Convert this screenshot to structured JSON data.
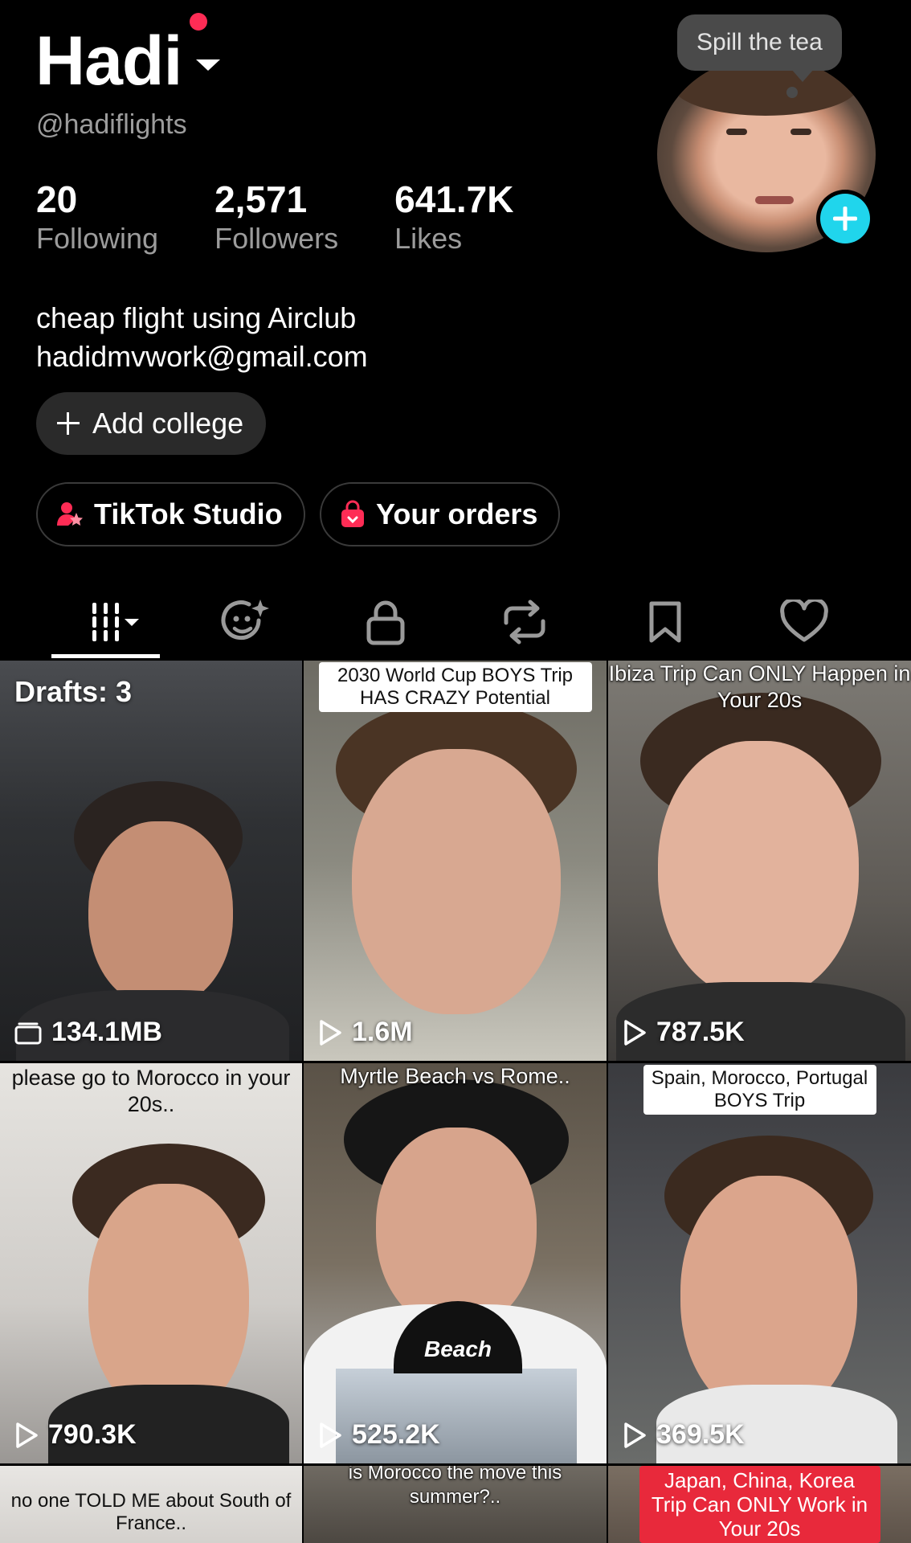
{
  "profile": {
    "name": "Hadi",
    "handle": "@hadiflights",
    "stats": [
      {
        "value": "20",
        "label": "Following"
      },
      {
        "value": "2,571",
        "label": "Followers"
      },
      {
        "value": "641.7K",
        "label": "Likes"
      }
    ],
    "bio_line1": "cheap flight using Airclub",
    "bio_line2": "hadidmvwork@gmail.com",
    "tooltip": "Spill the tea"
  },
  "buttons": {
    "add_college": "Add college",
    "studio": "TikTok Studio",
    "orders": "Your orders"
  },
  "tabs": [
    {
      "icon": "grid-icon",
      "active": true
    },
    {
      "icon": "face-sparkle-icon"
    },
    {
      "icon": "lock-icon"
    },
    {
      "icon": "repost-icon"
    },
    {
      "icon": "bookmark-icon"
    },
    {
      "icon": "heart-icon"
    }
  ],
  "videos": [
    {
      "drafts": "Drafts: 3",
      "meta": "134.1MB"
    },
    {
      "caption": "2030 World Cup BOYS Trip HAS CRAZY Potential",
      "views": "1.6M"
    },
    {
      "caption": "Ibiza Trip Can ONLY Happen in Your 20s",
      "views": "787.5K"
    },
    {
      "caption": "please go to Morocco in your 20s..",
      "views": "790.3K"
    },
    {
      "caption": "Myrtle Beach vs Rome..",
      "views": "525.2K",
      "overlay": "Beach"
    },
    {
      "caption": "Spain, Morocco, Portugal BOYS Trip",
      "views": "369.5K"
    },
    {
      "caption": "no one TOLD ME about South of France.."
    },
    {
      "caption": "is Morocco the move this summer?.."
    },
    {
      "caption": "Japan, China, Korea Trip Can ONLY Work in Your 20s"
    }
  ],
  "colors": {
    "background": "#000000",
    "accent_red": "#fe2c55",
    "accent_cyan": "#20d5ec",
    "muted_text": "#9c9c9c"
  }
}
